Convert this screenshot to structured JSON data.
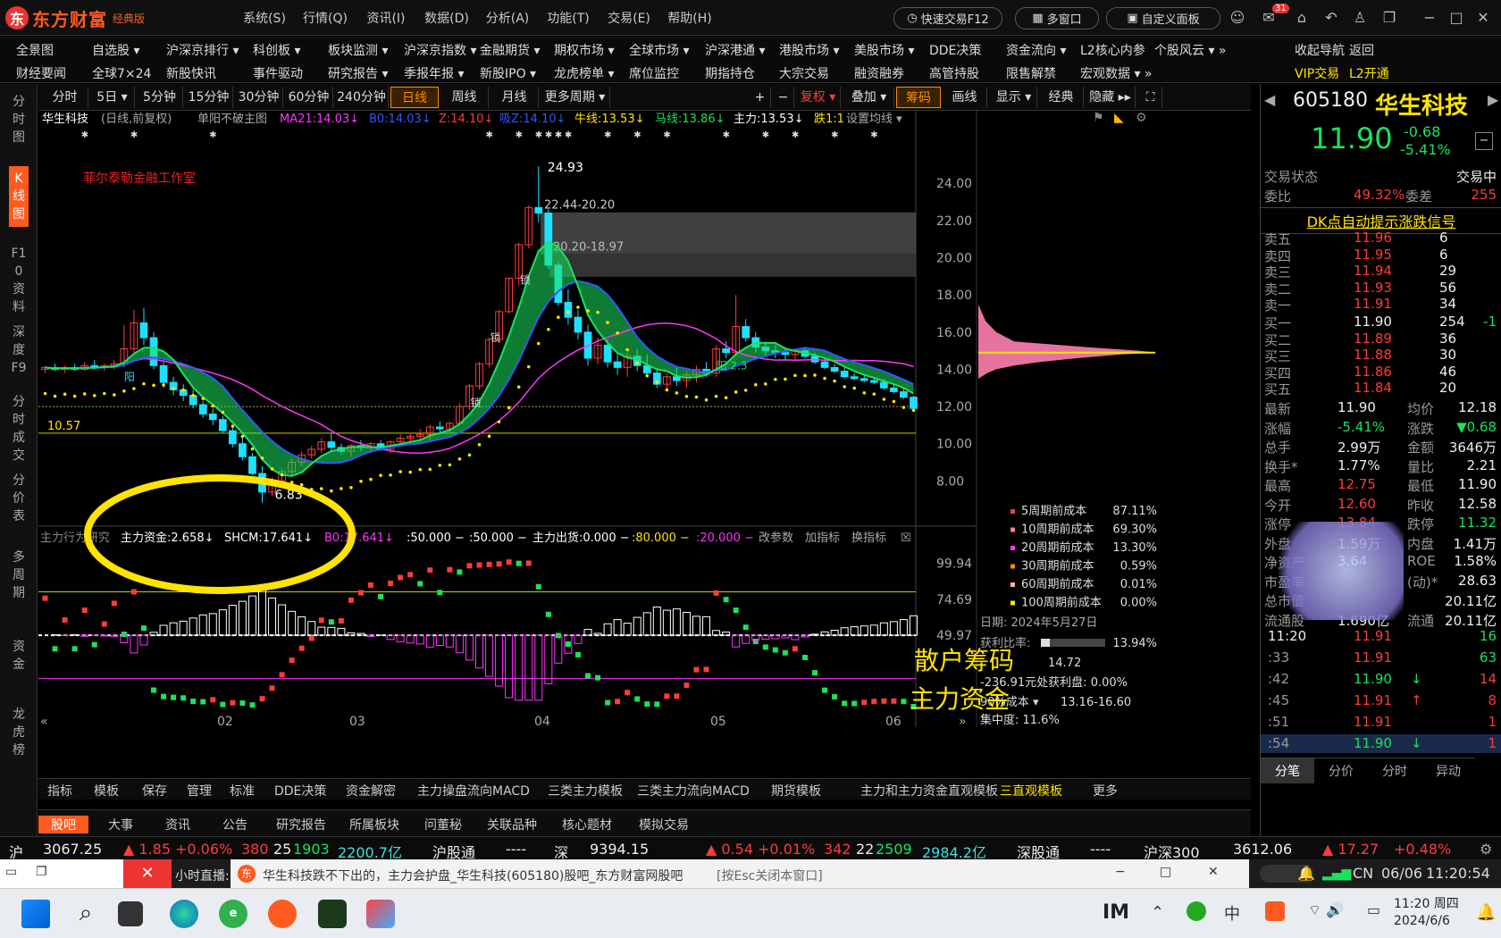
{
  "app": {
    "name": "东方财富",
    "edition": "经典版",
    "logo_letter": "东"
  },
  "main_menu": [
    "系统(S)",
    "行情(Q)",
    "资讯(I)",
    "数据(D)",
    "分析(A)",
    "功能(T)",
    "交易(E)",
    "帮助(H)"
  ],
  "title_buttons": {
    "quick_trade": "快速交易F12",
    "multi_window": "多窗口",
    "custom_panel": "自定义面板",
    "mail_badge": "31"
  },
  "nav1": [
    "全景图",
    "自选股 ▾",
    "沪深京排行 ▾",
    "科创板 ▾",
    "板块监测 ▾",
    "沪深京指数 ▾",
    "金融期货 ▾",
    "期权市场 ▾",
    "全球市场 ▾",
    "沪深港通 ▾",
    "港股市场 ▾",
    "美股市场 ▾",
    "DDE决策",
    "资金流向 ▾",
    "L2核心内参",
    "个股风云 ▾ »",
    "收起导航",
    "返回"
  ],
  "nav2": [
    "财经要闻",
    "全球7×24",
    "新股快讯",
    "事件驱动",
    "研究报告 ▾",
    "季报年报 ▾",
    "新股IPO ▾",
    "龙虎榜单 ▾",
    "席位监控",
    "期指持仓",
    "大宗交易",
    "融资融券",
    "高管持股",
    "限售解禁",
    "宏观数据 ▾ »",
    "VIP交易",
    "L2开通"
  ],
  "left_tabs": [
    "分时图",
    "K线图",
    "F10资料",
    "深度F9",
    "分时成交",
    "分价表",
    "多周期",
    "资金",
    "龙虎榜"
  ],
  "period_toolbar": [
    "分时",
    "5日 ▾",
    "5分钟",
    "15分钟",
    "30分钟",
    "60分钟",
    "240分钟",
    "日线",
    "周线",
    "月线",
    "更多周期 ▾"
  ],
  "chart_toolbar": [
    "+",
    "−",
    "复权 ▾",
    "叠加 ▾",
    "筹码",
    "画线",
    "显示 ▾",
    "经典",
    "隐藏 ▸▸"
  ],
  "indicator_header": {
    "name": "华生科技",
    "period": "(日线,前复权)",
    "mode": "单阳不破主图",
    "ma21": "MA21:14.03↓",
    "b0": "B0:14.03↓",
    "z": "Z:14.10↓",
    "xx": "吸Z:14.10↓",
    "niu": "牛线:13.53↓",
    "ma": "马线:13.86↓",
    "zhuli": "主力:13.53↓",
    "die": "跌1:1",
    "settings": "设置均线 ▾"
  },
  "watermark": "菲尔泰勒金融工作室",
  "price_axis": [
    "24.00",
    "22.00",
    "20.00",
    "18.00",
    "16.00",
    "14.00",
    "12.00",
    "10.00",
    "8.00"
  ],
  "price_annotations": {
    "high": "24.93",
    "low": "6.83",
    "support": "10.57",
    "zone1": "22.44-20.20",
    "zone2": "20.20-18.97",
    "lock": "锁",
    "yang": "阳",
    "yang2": "阳 2.3"
  },
  "sub_header": {
    "name": "主力行为研究",
    "zhuli_zijin": "主力资金:2.658↓",
    "shcm": "SHCM:17.641↓",
    "b0": "B0:17.641↓",
    "l50a": ":50.000 −",
    "l50b": ":50.000 −",
    "chuhuo": "主力出货:0.000 −",
    "l80": ":80.000 −",
    "l20": ":20.000 −",
    "params": "改参数",
    "add": "加指标",
    "swap": "换指标"
  },
  "sub_axis": [
    "99.94",
    "74.69",
    "49.97"
  ],
  "overlay_text": {
    "retail": "散户筹码",
    "main": "主力资金"
  },
  "date_axis": [
    "02",
    "03",
    "04",
    "05",
    "06"
  ],
  "cost_legend": [
    {
      "label": "5周期前成本",
      "value": "87.11%",
      "color": "#ff3b3b"
    },
    {
      "label": "10周期前成本",
      "value": "69.30%",
      "color": "#ff7f7f"
    },
    {
      "label": "20周期前成本",
      "value": "13.30%",
      "color": "#ff35ff"
    },
    {
      "label": "30周期前成本",
      "value": "0.59%",
      "color": "#ff8a00"
    },
    {
      "label": "60周期前成本",
      "value": "0.01%",
      "color": "#ffb0b0"
    },
    {
      "label": "100周期前成本",
      "value": "0.00%",
      "color": "#ffe400"
    }
  ],
  "chip_info": {
    "date": "日期: 2024年5月27日",
    "profit_label": "获利比率:",
    "profit": "13.94%",
    "avg_cost": "14.72",
    "pos_text": "-236.91元处获利盘: 0.00%",
    "cost_range_label": "90%成本 ▾",
    "cost_range": "13.16-16.60",
    "concentration": "集中度: 11.6%",
    "profit_fraction": 0.1394
  },
  "bottom_templates": [
    "指标",
    "模板",
    "保存",
    "管理",
    "标准",
    "DDE决策",
    "资金解密",
    "主力操盘流向MACD",
    "三类主力模板",
    "三类主力流向MACD",
    "期货模板",
    "主力和主力资金直观模板",
    "三直观模板",
    "更多"
  ],
  "bottom_news_tabs": [
    "股吧",
    "大事",
    "资讯",
    "公告",
    "研究报告",
    "所属板块",
    "问董秘",
    "关联品种",
    "核心题材",
    "模拟交易"
  ],
  "quote": {
    "code": "605180",
    "name": "华生科技",
    "price": "11.90",
    "change": "-0.68",
    "pct": "-5.41%",
    "state_label": "交易状态",
    "state": "交易中",
    "wb_label": "委比",
    "wb": "49.32%",
    "wc_label": "委差",
    "wc": "255",
    "signal": "DK点自动提示涨跌信号",
    "asks": [
      [
        "卖五",
        "11.96",
        "6"
      ],
      [
        "卖四",
        "11.95",
        "6"
      ],
      [
        "卖三",
        "11.94",
        "29"
      ],
      [
        "卖二",
        "11.93",
        "56"
      ],
      [
        "卖一",
        "11.91",
        "34"
      ]
    ],
    "bids": [
      [
        "买一",
        "11.90",
        "254"
      ],
      [
        "买二",
        "11.89",
        "36"
      ],
      [
        "买三",
        "11.88",
        "30"
      ],
      [
        "买四",
        "11.86",
        "46"
      ],
      [
        "买五",
        "11.84",
        "20"
      ]
    ],
    "bid1_delta": "-1",
    "stats": [
      [
        "最新",
        "11.90",
        "均价",
        "12.18"
      ],
      [
        "涨幅",
        "-5.41%",
        "涨跌",
        "▼0.68"
      ],
      [
        "总手",
        "2.99万",
        "金额",
        "3646万"
      ],
      [
        "换手*",
        "1.77%",
        "量比",
        "2.21"
      ],
      [
        "最高",
        "12.75",
        "最低",
        "11.90"
      ],
      [
        "今开",
        "12.60",
        "昨收",
        "12.58"
      ],
      [
        "涨停",
        "13.84",
        "跌停",
        "11.32"
      ],
      [
        "外盘",
        "1.59万",
        "内盘",
        "1.41万"
      ],
      [
        "净资产",
        "3.64",
        "ROE",
        "1.58%"
      ],
      [
        "市盈率",
        "",
        "(动)*",
        "28.63"
      ],
      [
        "总市值",
        "",
        "",
        "20.11亿"
      ],
      [
        "流通股",
        "1.690亿",
        "流通",
        "20.11亿"
      ]
    ],
    "ticks": [
      [
        "11:20",
        "11.91",
        "16",
        ""
      ],
      [
        ":33",
        "11.91",
        "63",
        ""
      ],
      [
        ":42",
        "11.90",
        "14",
        "↓"
      ],
      [
        ":45",
        "11.91",
        "8",
        "↑"
      ],
      [
        ":51",
        "11.91",
        "1",
        ""
      ],
      [
        ":54",
        "11.90",
        "1",
        "↓"
      ]
    ],
    "tabs": [
      "分笔",
      "分价",
      "分时",
      "异动"
    ]
  },
  "ticker": {
    "sh": "沪",
    "sh_val": "3067.25",
    "sh_chg": "▲ 1.85",
    "sh_pct": "+0.06%",
    "sh_up": "380",
    "sh_flat": "25",
    "sh_down": "1903",
    "sh_amt": "2200.7亿",
    "hgt": "沪股通",
    "hgt_v": "----",
    "sz": "深",
    "sz_val": "9394.15",
    "sz_chg": "▲ 0.54",
    "sz_pct": "+0.01%",
    "sz_up": "342",
    "sz_flat": "22",
    "sz_down": "2509",
    "sz_amt": "2984.2亿",
    "sgt": "深股通",
    "sgt_v": "----",
    "hs300": "沪深300",
    "hs_val": "3612.06",
    "hs_chg": "▲ 17.27",
    "hs_pct": "+0.48%"
  },
  "browser": {
    "live": "小时直播:",
    "tab": "华生科技跌不下出的，主力会护盘_华生科技(605180)股吧_东方财富网股吧",
    "esc": "[按Esc关闭本窗口]"
  },
  "systray": {
    "lang": "CN",
    "date": "06/06",
    "time": "11:20:54"
  },
  "taskbar": {
    "time": "11:20 周四",
    "date": "2024/6/6",
    "lang": "中"
  },
  "chart_data": {
    "type": "candlestick",
    "price_range": [
      6.0,
      25.5
    ],
    "support_line": 10.57,
    "candles": [
      [
        14.0,
        14.2,
        13.8,
        14.1
      ],
      [
        14.1,
        14.3,
        13.9,
        14.0
      ],
      [
        14.0,
        14.2,
        13.8,
        14.1
      ],
      [
        14.1,
        14.3,
        13.9,
        14.0
      ],
      [
        14.0,
        14.4,
        13.9,
        14.2
      ],
      [
        14.2,
        14.5,
        14.0,
        14.1
      ],
      [
        14.1,
        14.3,
        13.9,
        14.2
      ],
      [
        14.2,
        14.5,
        14.0,
        14.3
      ],
      [
        14.3,
        16.4,
        14.1,
        15.1
      ],
      [
        15.1,
        17.2,
        14.9,
        16.5
      ],
      [
        16.5,
        17.3,
        15.3,
        15.7
      ],
      [
        15.7,
        16.0,
        14.0,
        14.2
      ],
      [
        14.2,
        14.4,
        13.0,
        13.3
      ],
      [
        13.3,
        13.6,
        12.6,
        12.9
      ],
      [
        12.9,
        13.2,
        12.3,
        12.6
      ],
      [
        12.6,
        12.9,
        11.9,
        12.1
      ],
      [
        12.1,
        12.3,
        11.4,
        11.6
      ],
      [
        11.6,
        11.9,
        11.0,
        11.3
      ],
      [
        11.3,
        11.5,
        10.6,
        10.7
      ],
      [
        10.7,
        11.0,
        9.8,
        10.0
      ],
      [
        10.0,
        10.3,
        9.1,
        9.3
      ],
      [
        9.3,
        9.5,
        8.3,
        8.4
      ],
      [
        8.4,
        8.8,
        6.83,
        7.4
      ],
      [
        7.4,
        8.2,
        7.2,
        8.0
      ],
      [
        8.0,
        8.7,
        7.8,
        8.5
      ],
      [
        8.5,
        9.2,
        8.3,
        9.0
      ],
      [
        9.0,
        9.6,
        8.8,
        9.4
      ],
      [
        9.4,
        9.9,
        9.2,
        9.7
      ],
      [
        9.7,
        10.3,
        9.5,
        10.1
      ],
      [
        10.1,
        10.6,
        9.6,
        9.8
      ],
      [
        9.8,
        10.0,
        9.4,
        9.6
      ],
      [
        9.6,
        10.0,
        9.3,
        9.9
      ],
      [
        9.9,
        10.2,
        9.6,
        9.8
      ],
      [
        9.8,
        10.1,
        9.5,
        10.0
      ],
      [
        10.0,
        10.2,
        9.6,
        9.7
      ],
      [
        9.7,
        10.2,
        9.5,
        10.1
      ],
      [
        10.1,
        10.5,
        9.9,
        10.3
      ],
      [
        10.3,
        10.6,
        10.0,
        10.4
      ],
      [
        10.4,
        10.8,
        10.1,
        10.5
      ],
      [
        10.5,
        11.0,
        10.2,
        10.9
      ],
      [
        10.9,
        11.2,
        10.5,
        10.8
      ],
      [
        10.8,
        11.2,
        10.6,
        11.1
      ],
      [
        11.1,
        12.2,
        11.0,
        12.0
      ],
      [
        12.0,
        13.2,
        11.8,
        13.1
      ],
      [
        13.1,
        14.4,
        12.9,
        14.3
      ],
      [
        14.3,
        15.7,
        14.1,
        15.6
      ],
      [
        15.6,
        17.2,
        15.4,
        17.1
      ],
      [
        17.1,
        18.9,
        17.0,
        18.9
      ],
      [
        18.9,
        20.8,
        18.5,
        20.7
      ],
      [
        20.7,
        22.8,
        20.5,
        22.7
      ],
      [
        22.7,
        24.93,
        21.9,
        22.4
      ],
      [
        22.4,
        22.6,
        19.4,
        19.6
      ],
      [
        19.6,
        19.8,
        17.4,
        17.6
      ],
      [
        17.6,
        18.3,
        16.4,
        16.8
      ],
      [
        16.8,
        17.2,
        15.6,
        16.0
      ],
      [
        16.0,
        16.4,
        14.2,
        14.6
      ],
      [
        14.6,
        15.7,
        14.3,
        15.3
      ],
      [
        15.3,
        15.6,
        14.1,
        14.4
      ],
      [
        14.4,
        14.9,
        13.7,
        14.1
      ],
      [
        14.1,
        14.9,
        13.6,
        14.7
      ],
      [
        14.7,
        15.1,
        13.9,
        14.2
      ],
      [
        14.2,
        14.8,
        13.6,
        13.8
      ],
      [
        13.8,
        14.0,
        13.0,
        13.2
      ],
      [
        13.2,
        13.8,
        12.9,
        13.6
      ],
      [
        13.6,
        14.1,
        13.1,
        13.4
      ],
      [
        13.4,
        13.9,
        13.0,
        13.7
      ],
      [
        13.7,
        14.2,
        13.3,
        14.0
      ],
      [
        14.0,
        14.4,
        13.6,
        13.8
      ],
      [
        13.8,
        15.3,
        13.6,
        15.1
      ],
      [
        15.1,
        15.5,
        14.6,
        14.9
      ],
      [
        14.9,
        18.0,
        14.7,
        16.3
      ],
      [
        16.3,
        16.7,
        15.5,
        15.7
      ],
      [
        15.7,
        16.0,
        14.9,
        15.2
      ],
      [
        15.2,
        15.5,
        14.7,
        15.0
      ],
      [
        15.0,
        15.3,
        14.6,
        14.9
      ],
      [
        14.9,
        15.2,
        14.5,
        14.8
      ],
      [
        14.8,
        15.1,
        14.5,
        15.0
      ],
      [
        15.0,
        15.2,
        14.6,
        14.7
      ],
      [
        14.7,
        14.9,
        14.3,
        14.4
      ],
      [
        14.4,
        14.6,
        14.0,
        14.1
      ],
      [
        14.1,
        14.3,
        13.8,
        13.9
      ],
      [
        13.9,
        14.1,
        13.5,
        13.6
      ],
      [
        13.6,
        13.8,
        13.4,
        13.5
      ],
      [
        13.5,
        13.7,
        13.3,
        13.4
      ],
      [
        13.4,
        13.6,
        13.2,
        13.3
      ],
      [
        13.3,
        13.5,
        12.9,
        13.0
      ],
      [
        13.0,
        13.2,
        12.7,
        12.8
      ],
      [
        12.8,
        13.0,
        12.4,
        12.5
      ],
      [
        12.5,
        12.6,
        11.9,
        11.9
      ]
    ]
  }
}
